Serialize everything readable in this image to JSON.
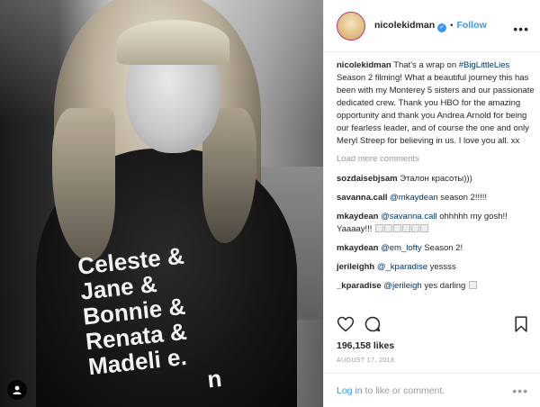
{
  "header": {
    "username": "nicolekidman",
    "separator": "•",
    "follow_label": "Follow"
  },
  "photo": {
    "shirt_lines": [
      "Celeste &",
      "Jane &",
      "Bonnie &",
      "Renata &",
      "Madeli e.",
      "n"
    ]
  },
  "caption": {
    "username": "nicolekidman",
    "text_before": "That's a wrap on ",
    "hashtag": "#BigLittleLies",
    "text_after": " Season 2 filming! What a beautiful journey this has been with my Monterey 5 sisters and our passionate dedicated crew. Thank you HBO for the amazing opportunity and thank you Andrea Arnold for being our fearless leader, and of course the one and only Meryl Streep for believing in us. I love you all. xx"
  },
  "load_more_label": "Load more comments",
  "comments": [
    {
      "user": "sozdaisebjsam",
      "mention": "",
      "text": "Эталон красоты)))"
    },
    {
      "user": "savanna.call",
      "mention": "@mkaydean",
      "text": " season 2!!!!!"
    },
    {
      "user": "mkaydean",
      "mention": "@savanna.call",
      "text": " ohhhhh my gosh!! Yaaaay!!!"
    },
    {
      "user": "mkaydean",
      "mention": "@em_lofty",
      "text": " Season 2!"
    },
    {
      "user": "jerileighh",
      "mention": "@_kparadise",
      "text": " yessss"
    },
    {
      "user": "_kparadise",
      "mention": "@jerileigh",
      "text": " yes darling"
    }
  ],
  "likes": "196,158 likes",
  "date": "AUGUST 17, 2018",
  "footer": {
    "login_label": "Log in",
    "rest": " to like or comment."
  },
  "colors": {
    "accent_blue": "#3897f0",
    "link_dark": "#003569",
    "muted": "#999999"
  }
}
